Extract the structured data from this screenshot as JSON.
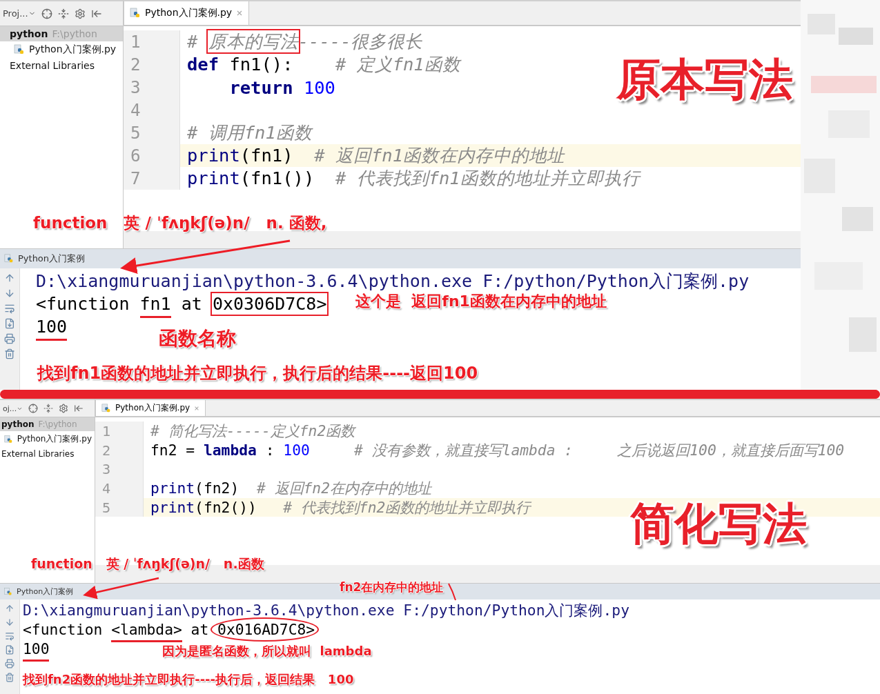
{
  "screens": [
    {
      "toolbar_label": "Proj...",
      "project": {
        "name": "python",
        "path": "F:\\python",
        "selected": true,
        "files": [
          "Python入门案例.py"
        ],
        "libraries": "External Libraries"
      },
      "tab": {
        "label": "Python入门案例.py",
        "selected": true
      },
      "code_lines": [
        {
          "number": "1",
          "highlighted": false,
          "tokens": [
            {
              "kind": "comment",
              "text": "# "
            },
            {
              "kind": "comment",
              "text": "原本的写法",
              "boxed": true
            },
            {
              "kind": "comment",
              "text": "-----很多很长"
            }
          ]
        },
        {
          "number": "2",
          "highlighted": false,
          "tokens": [
            {
              "kind": "keyword",
              "text": "def"
            },
            {
              "kind": "plain",
              "text": " fn1():    "
            },
            {
              "kind": "comment",
              "text": "# 定义fn1函数"
            }
          ]
        },
        {
          "number": "3",
          "highlighted": false,
          "tokens": [
            {
              "kind": "keyword",
              "text": "    return "
            },
            {
              "kind": "number",
              "text": "100"
            }
          ]
        },
        {
          "number": "4",
          "highlighted": false
        },
        {
          "number": "5",
          "highlighted": false,
          "tokens": [
            {
              "kind": "comment",
              "text": "# 调用fn1函数"
            }
          ]
        },
        {
          "number": "6",
          "highlighted": true,
          "tokens": [
            {
              "kind": "builtin",
              "text": "print"
            },
            {
              "kind": "plain",
              "text": "(fn1)  "
            },
            {
              "kind": "comment",
              "text": "# 返回fn1函数在内存中的地址"
            }
          ]
        },
        {
          "number": "7",
          "highlighted": false,
          "tokens": [
            {
              "kind": "builtin",
              "text": "print"
            },
            {
              "kind": "plain",
              "text": "(fn1())  "
            },
            {
              "kind": "comment",
              "text": "# 代表找到fn1函数的地址并立即执行"
            }
          ]
        }
      ],
      "run": {
        "title": "Python入门案例",
        "lines": [
          {
            "tokens": [
              {
                "kind": "path",
                "text": "D:\\xiangmuruanjian\\python-3.6.4\\python.exe F:/python/Python入门案例.py"
              }
            ]
          },
          {
            "tokens": [
              {
                "kind": "plain",
                "text": "<function "
              },
              {
                "kind": "plain",
                "text": "fn1",
                "underlined": true
              },
              {
                "kind": "plain",
                "text": " at "
              },
              {
                "kind": "plain",
                "text": "0x0306D7C8>",
                "boxed": true
              }
            ]
          },
          {
            "tokens": [
              {
                "kind": "plain",
                "text": "100",
                "underlined": true
              }
            ]
          }
        ]
      },
      "title_overlay": "原本写法",
      "notes": [
        "function   英 / ˈfʌŋkʃ(ə)n/   n. 函数,",
        "这个是  返回fn1函数在内存中的地址",
        "函数名称",
        "找到fn1函数的地址并立即执行，执行后的结果----返回100"
      ]
    },
    {
      "toolbar_label": "oj...",
      "project": {
        "name": "python",
        "path": "F:\\python",
        "selected": true,
        "files": [
          "Python入门案例.py"
        ],
        "libraries": "External Libraries"
      },
      "tab": {
        "label": "Python入门案例.py",
        "selected": true
      },
      "code_lines": [
        {
          "number": "1",
          "highlighted": false,
          "tokens": [
            {
              "kind": "comment",
              "text": "# 简化写法-----定义fn2函数"
            }
          ]
        },
        {
          "number": "2",
          "highlighted": false,
          "tokens": [
            {
              "kind": "plain",
              "text": "fn2 = "
            },
            {
              "kind": "keyword",
              "text": "lambda"
            },
            {
              "kind": "plain",
              "text": " : "
            },
            {
              "kind": "number",
              "text": "100"
            },
            {
              "kind": "comment",
              "text": "     # 没有参数，就直接写lambda :     之后说返回100，就直接后面写100"
            }
          ]
        },
        {
          "number": "3",
          "highlighted": false
        },
        {
          "number": "4",
          "highlighted": false,
          "tokens": [
            {
              "kind": "builtin",
              "text": "print"
            },
            {
              "kind": "plain",
              "text": "(fn2)  "
            },
            {
              "kind": "comment",
              "text": "# 返回fn2在内存中的地址"
            }
          ]
        },
        {
          "number": "5",
          "highlighted": true,
          "tokens": [
            {
              "kind": "builtin",
              "text": "print"
            },
            {
              "kind": "plain",
              "text": "(fn2())   "
            },
            {
              "kind": "comment",
              "text": "# 代表找到fn2函数的地址并立即执行"
            }
          ]
        }
      ],
      "run": {
        "title": "Python入门案例",
        "lines": [
          {
            "tokens": [
              {
                "kind": "path",
                "text": "D:\\xiangmuruanjian\\python-3.6.4\\python.exe F:/python/Python入门案例.py"
              }
            ]
          },
          {
            "tokens": [
              {
                "kind": "plain",
                "text": "<function "
              },
              {
                "kind": "plain",
                "text": "<lambda>",
                "underlined": true
              },
              {
                "kind": "plain",
                "text": " at "
              },
              {
                "kind": "plain",
                "text": "0x016AD7C8>",
                "circled": true
              }
            ]
          },
          {
            "tokens": [
              {
                "kind": "plain",
                "text": "100",
                "underlined": true
              }
            ]
          }
        ]
      },
      "title_overlay": "简化写法",
      "notes": [
        "function   英 / ˈfʌŋkʃ(ə)n/   n.函数",
        "fn2在内存中的地址",
        "因为是匿名函数，所以就叫  lambda",
        "找到fn2函数的地址并立即执行----执行后，返回结果   100"
      ]
    }
  ]
}
